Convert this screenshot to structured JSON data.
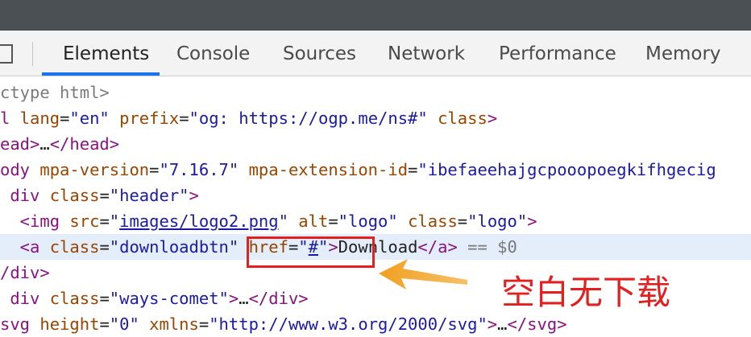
{
  "tabs": [
    {
      "label": "Elements",
      "active": true
    },
    {
      "label": "Console"
    },
    {
      "label": "Sources"
    },
    {
      "label": "Network"
    },
    {
      "label": "Performance"
    },
    {
      "label": "Memory"
    }
  ],
  "dom": {
    "l1": {
      "p1": "ctype html>"
    },
    "l2": {
      "tag": "l",
      "a1": " lang",
      "eq1": "=",
      "v1": "\"en\"",
      "a2": " prefix",
      "eq2": "=",
      "v2": "\"og: https://ogp.me/ns#\"",
      "a3": " class",
      "end": ">"
    },
    "l3": {
      "t1": "ead",
      "t2": ">",
      "dots": "…",
      "t3": "</head>"
    },
    "l4": {
      "t1": "ody",
      "a1": " mpa-version",
      "eq1": "=",
      "v1": "\"7.16.7\"",
      "a2": " mpa-extension-id",
      "eq2": "=",
      "v2": "\"ibefaeehajgcpooopoegkifhgecig"
    },
    "l5": {
      "t1": " div",
      "a1": " class",
      "eq1": "=",
      "v1": "\"header\"",
      "t2": ">"
    },
    "l6": {
      "t1": "  <img",
      "a1": " src",
      "eq1": "=",
      "q1": "\"",
      "link": "images/logo2.png",
      "q2": "\"",
      "a2": " alt",
      "eq2": "=",
      "v2": "\"logo\"",
      "a3": " class",
      "eq3": "=",
      "v3": "\"logo\"",
      "t2": ">"
    },
    "l7": {
      "t1": "  <a",
      "a1": " class",
      "eq1": "=",
      "v1": "\"downloadbtn\"",
      "a2": " href",
      "eq2": "=",
      "q1": "\"",
      "link": "#",
      "q2": "\"",
      "t2": ">",
      "text": "Download",
      "t3": "</a>",
      "marker": " == $0"
    },
    "l8": {
      "t1": "/div>"
    },
    "l9": {
      "t1": " div",
      "a1": " class",
      "eq1": "=",
      "v1": "\"ways-comet\"",
      "t2": ">",
      "dots": "…",
      "t3": "</div>"
    },
    "l10": {
      "t1": "svg",
      "a1": " height",
      "eq1": "=",
      "v1": "\"0\"",
      "a2": " xmlns",
      "eq2": "=",
      "v2": "\"http://www.w3.org/2000/svg\"",
      "t2": ">",
      "dots": "…",
      "t3": "</svg>"
    }
  },
  "annotation": {
    "text": "空白无下载",
    "color": "#e32020"
  },
  "colors": {
    "tag": "#881280",
    "attr": "#994500",
    "value": "#1a1aa6",
    "accent": "#1a73e8"
  }
}
